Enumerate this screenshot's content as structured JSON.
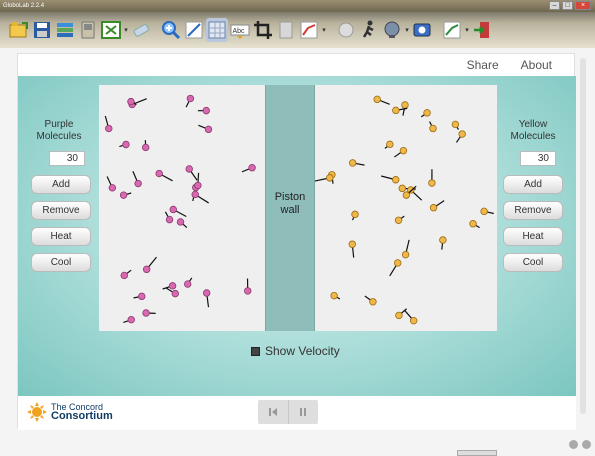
{
  "window": {
    "title": "GloboLab 2.2.4"
  },
  "toolbar": {
    "icons": [
      "folder-open-icon",
      "save-icon",
      "books-icon",
      "device-icon",
      "spreadsheet-icon",
      "eraser-icon",
      "zoom-icon",
      "line-icon",
      "grid-icon",
      "text-icon",
      "crop-icon",
      "page-icon",
      "graph-icon",
      "circle-icon",
      "runner-icon",
      "globe-icon",
      "camera-icon",
      "chart-icon",
      "exit-icon"
    ]
  },
  "nav": {
    "share": "Share",
    "about": "About"
  },
  "left_panel": {
    "label_line1": "Purple",
    "label_line2": "Molecules",
    "count": "30",
    "buttons": [
      "Add",
      "Remove",
      "Heat",
      "Cool"
    ]
  },
  "right_panel": {
    "label_line1": "Yellow",
    "label_line2": "Molecules",
    "count": "30",
    "buttons": [
      "Add",
      "Remove",
      "Heat",
      "Cool"
    ]
  },
  "piston": {
    "line1": "Piston",
    "line2": "wall"
  },
  "show_velocity": {
    "label": "Show Velocity",
    "checked": true
  },
  "footer": {
    "logo_line1": "The Concord",
    "logo_line2": "Consortium"
  },
  "colors": {
    "purple_molecule": "#d868b0",
    "yellow_molecule": "#f0b84a",
    "piston": "#8ebdba",
    "teal": "#a9dcd8"
  }
}
